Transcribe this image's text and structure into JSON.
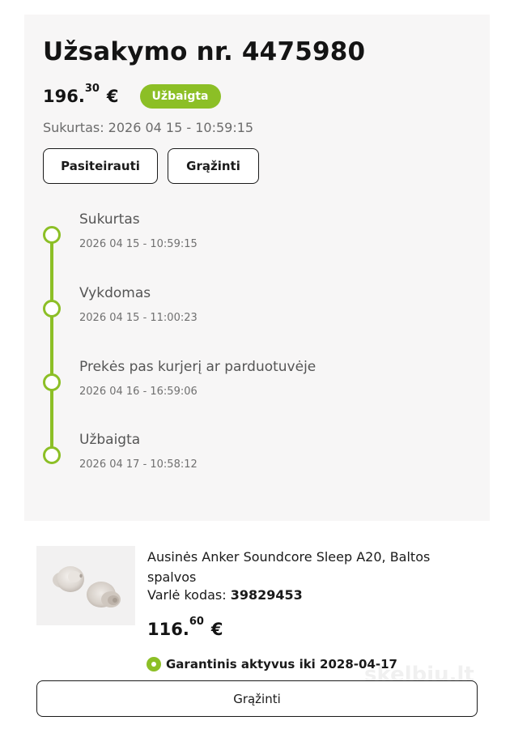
{
  "order": {
    "title": "Užsakymo nr. 4475980",
    "price_main": "196.",
    "price_cents": "30",
    "currency": "€",
    "status": "Užbaigta",
    "created": "Sukurtas: 2026 04 15 - 10:59:15",
    "inquire_label": "Pasiteirauti",
    "return_label": "Grąžinti"
  },
  "timeline": [
    {
      "label": "Sukurtas",
      "date": "2026 04 15 - 10:59:15"
    },
    {
      "label": "Vykdomas",
      "date": "2026 04 15 - 11:00:23"
    },
    {
      "label": "Prekės pas kurjerį ar parduotuvėje",
      "date": "2026 04 16 - 16:59:06"
    },
    {
      "label": "Užbaigta",
      "date": "2026 04 17 - 10:58:12"
    }
  ],
  "product": {
    "name": "Ausinės Anker Soundcore Sleep A20, Baltos spalvos",
    "code_label": "Varlė kodas:",
    "code_value": "39829453",
    "price_main": "116.",
    "price_cents": "60",
    "currency": "€",
    "warranty": "Garantinis aktyvus iki 2028-04-17",
    "return_label": "Grąžinti"
  },
  "watermark": "skelbiu.lt",
  "colors": {
    "accent": "#8cbf26",
    "card_bg": "#f7f6f6",
    "text": "#1a1a1a",
    "muted": "#6b6b6b"
  },
  "icons": {
    "timeline_step": "circle-outline-icon",
    "warranty": "check-circle-icon"
  }
}
